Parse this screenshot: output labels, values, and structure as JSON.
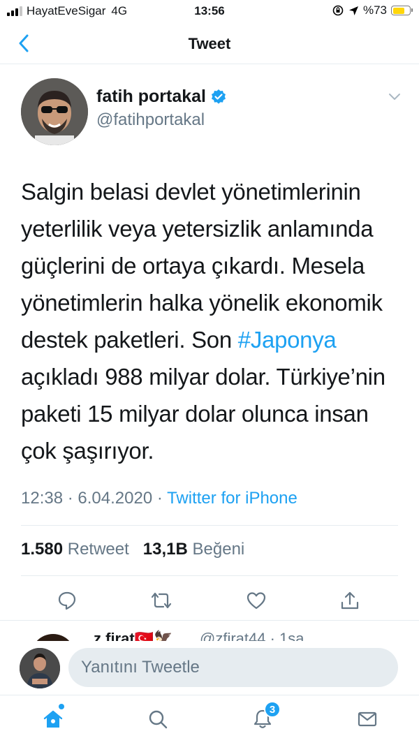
{
  "status_bar": {
    "carrier": "HayatEveSigar",
    "network": "4G",
    "time": "13:56",
    "battery": "%73",
    "battery_level": 0.73
  },
  "nav": {
    "title": "Tweet"
  },
  "tweet": {
    "author_name": "fatih portakal",
    "author_handle": "@fatihportakal",
    "text_before": "Salgin belasi devlet yönetimlerinin yeterlilik veya yetersizlik anlamında güçlerini de ortaya çıkardı. Mesela yönetimlerin halka yönelik ekonomik destek paketleri. Son ",
    "hashtag": "#Japonya",
    "text_after": " açıkladı 988 milyar dolar. Türkiye’nin paketi 15 milyar dolar olunca insan çok şaşırıyor.",
    "time": "12:38",
    "date": "6.04.2020",
    "source": "Twitter for iPhone",
    "retweet_count": "1.580",
    "retweet_label": "Retweet",
    "like_count": "13,1B",
    "like_label": "Beğeni"
  },
  "next_reply": {
    "name": "z firat🇹🇷🦅",
    "handle": "@zfirat44 · 1sa"
  },
  "reply_bar": {
    "placeholder": "Yanıtını Tweetle"
  },
  "tab_bar": {
    "notifications_badge": "3"
  },
  "colors": {
    "accent": "#1da1f2",
    "text": "#14171a",
    "muted": "#657786",
    "divider": "#e6ecf0"
  }
}
